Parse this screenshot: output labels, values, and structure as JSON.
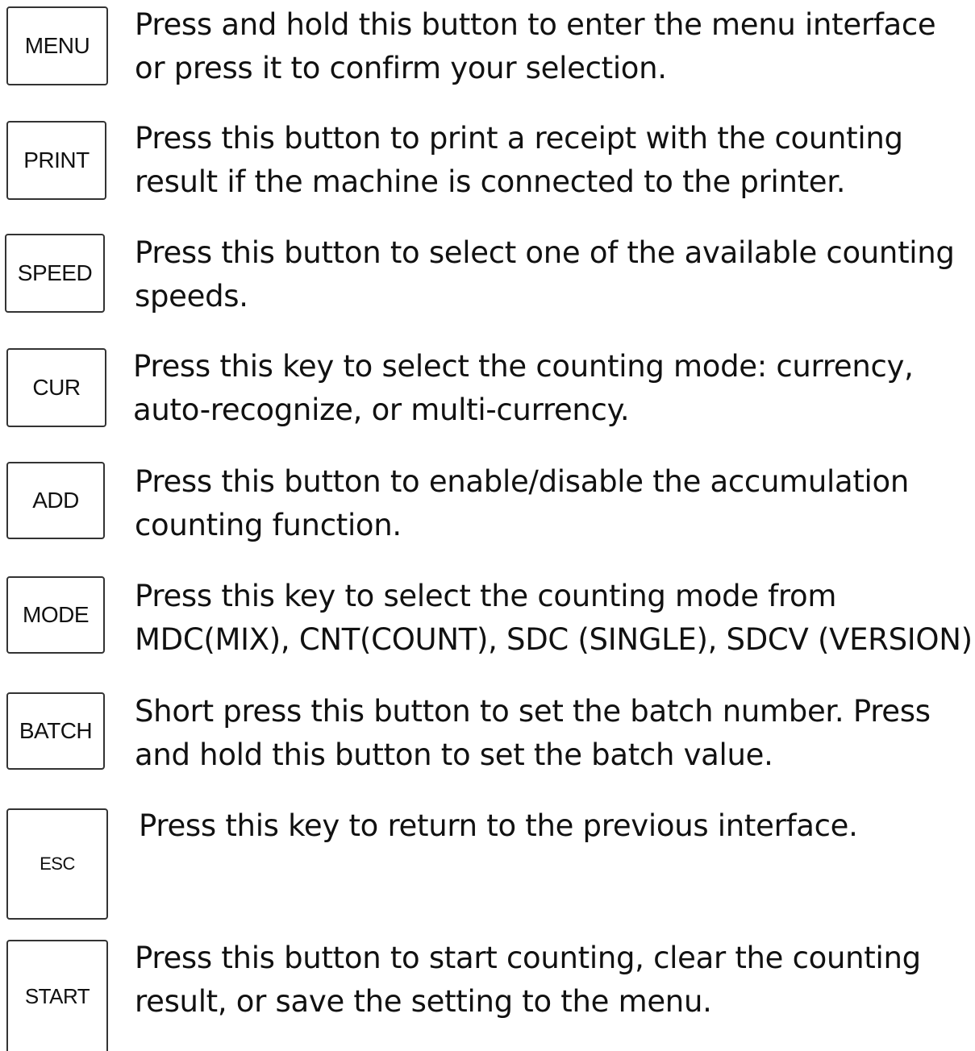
{
  "items": [
    {
      "key": "MENU",
      "lines": [
        "Press and hold this button to enter the menu interface",
        "or press it to confirm your selection."
      ]
    },
    {
      "key": "PRINT",
      "lines": [
        "Press this button to print a receipt with the counting",
        "result if the machine is connected to the printer."
      ]
    },
    {
      "key": "SPEED",
      "lines": [
        "Press this button to select one of the available counting",
        "speeds."
      ]
    },
    {
      "key": "CUR",
      "lines": [
        "Press this key to select the counting mode: currency,",
        "auto-recognize, or multi-currency."
      ]
    },
    {
      "key": "ADD",
      "lines": [
        "Press this button to enable/disable the accumulation",
        "counting function."
      ]
    },
    {
      "key": "MODE",
      "lines": [
        "Press this key to select the counting mode from",
        "MDC(MIX), CNT(COUNT), SDC (SINGLE), SDCV (VERSION)."
      ]
    },
    {
      "key": "BATCH",
      "lines": [
        "Short press this button to set the batch number. Press",
        "and hold this button to set the batch value."
      ]
    },
    {
      "key": "ESC",
      "lines": [
        "Press this key to return to the previous interface."
      ]
    },
    {
      "key": "START",
      "lines": [
        "Press this button to start counting, clear the counting",
        "result, or save the setting to the menu."
      ]
    }
  ]
}
